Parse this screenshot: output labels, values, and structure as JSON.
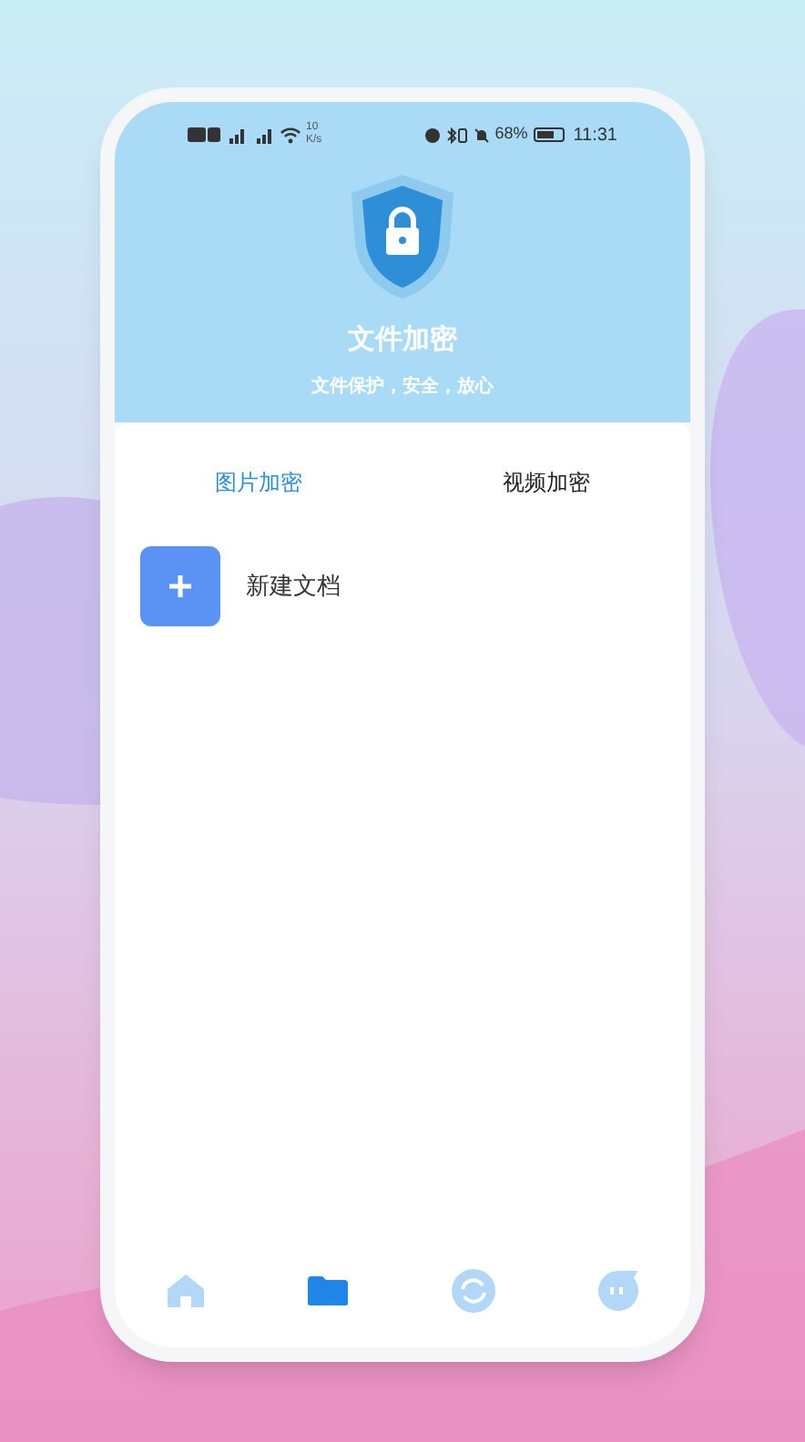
{
  "status_bar": {
    "net_speed": "10",
    "net_speed_unit": "K/s",
    "battery": "68%",
    "time": "11:31"
  },
  "header": {
    "title": "文件加密",
    "subtitle": "文件保护，安全，放心"
  },
  "tabs": [
    {
      "label": "图片加密",
      "selected": true
    },
    {
      "label": "视频加密",
      "selected": false
    }
  ],
  "items": [
    {
      "label": "新建文档"
    }
  ],
  "bottom_nav": [
    {
      "kind": "home",
      "selected": false
    },
    {
      "kind": "folder",
      "selected": true
    },
    {
      "kind": "sync",
      "selected": false
    },
    {
      "kind": "chat",
      "selected": false
    }
  ]
}
